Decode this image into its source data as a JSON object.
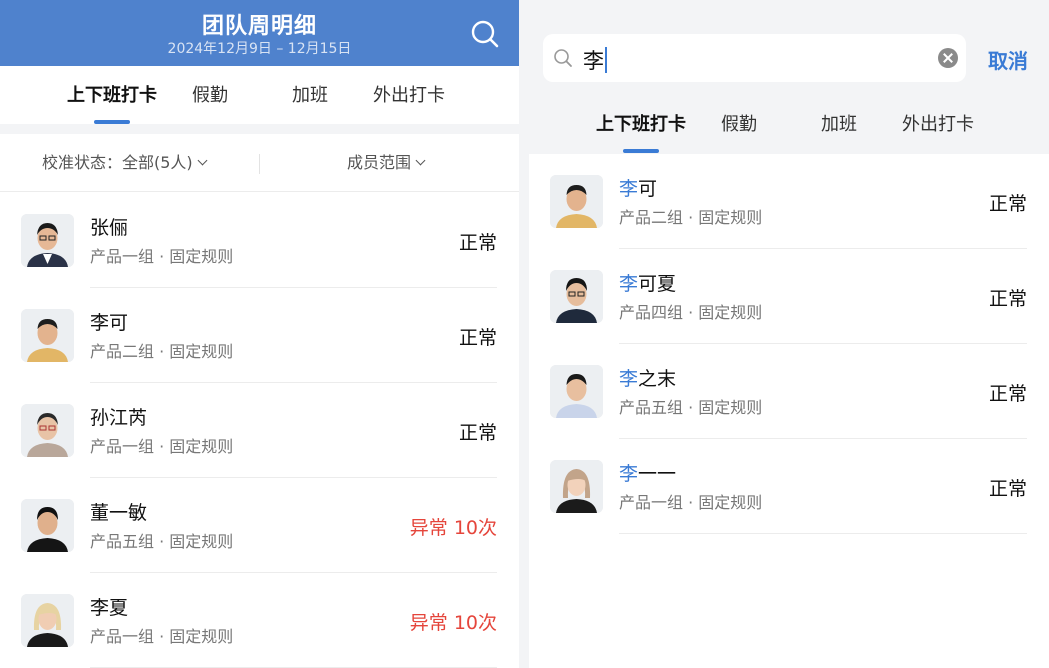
{
  "left": {
    "header": {
      "title": "团队周明细",
      "date_range": "2024年12月9日 – 12月15日"
    },
    "tabs": [
      "上下班打卡",
      "假勤",
      "加班",
      "外出打卡"
    ],
    "active_tab": 0,
    "filter": {
      "status_label": "校准状态：全部(5人)",
      "range_label": "成员范围"
    },
    "members": [
      {
        "name": "张俪",
        "sub": "产品一组 · 固定规则",
        "status": "正常",
        "abnormal": false
      },
      {
        "name": "李可",
        "sub": "产品二组 · 固定规则",
        "status": "正常",
        "abnormal": false
      },
      {
        "name": "孙江芮",
        "sub": "产品一组 · 固定规则",
        "status": "正常",
        "abnormal": false
      },
      {
        "name": "董一敏",
        "sub": "产品五组 · 固定规则",
        "status": "异常 10次",
        "abnormal": true
      },
      {
        "name": "李夏",
        "sub": "产品一组 · 固定规则",
        "status": "异常 10次",
        "abnormal": true
      }
    ]
  },
  "right": {
    "search": {
      "query": "李",
      "cancel_label": "取消"
    },
    "tabs": [
      "上下班打卡",
      "假勤",
      "加班",
      "外出打卡"
    ],
    "active_tab": 0,
    "results": [
      {
        "match": "李",
        "rest": "可",
        "sub": "产品二组 · 固定规则",
        "status": "正常"
      },
      {
        "match": "李",
        "rest": "可夏",
        "sub": "产品四组 · 固定规则",
        "status": "正常"
      },
      {
        "match": "李",
        "rest": "之末",
        "sub": "产品五组 · 固定规则",
        "status": "正常"
      },
      {
        "match": "李",
        "rest": "一一",
        "sub": "产品一组 · 固定规则",
        "status": "正常"
      }
    ]
  },
  "colors": {
    "header_blue": "#4f82cd",
    "accent_blue": "#3a7bd5",
    "abnormal_red": "#e5453b"
  }
}
